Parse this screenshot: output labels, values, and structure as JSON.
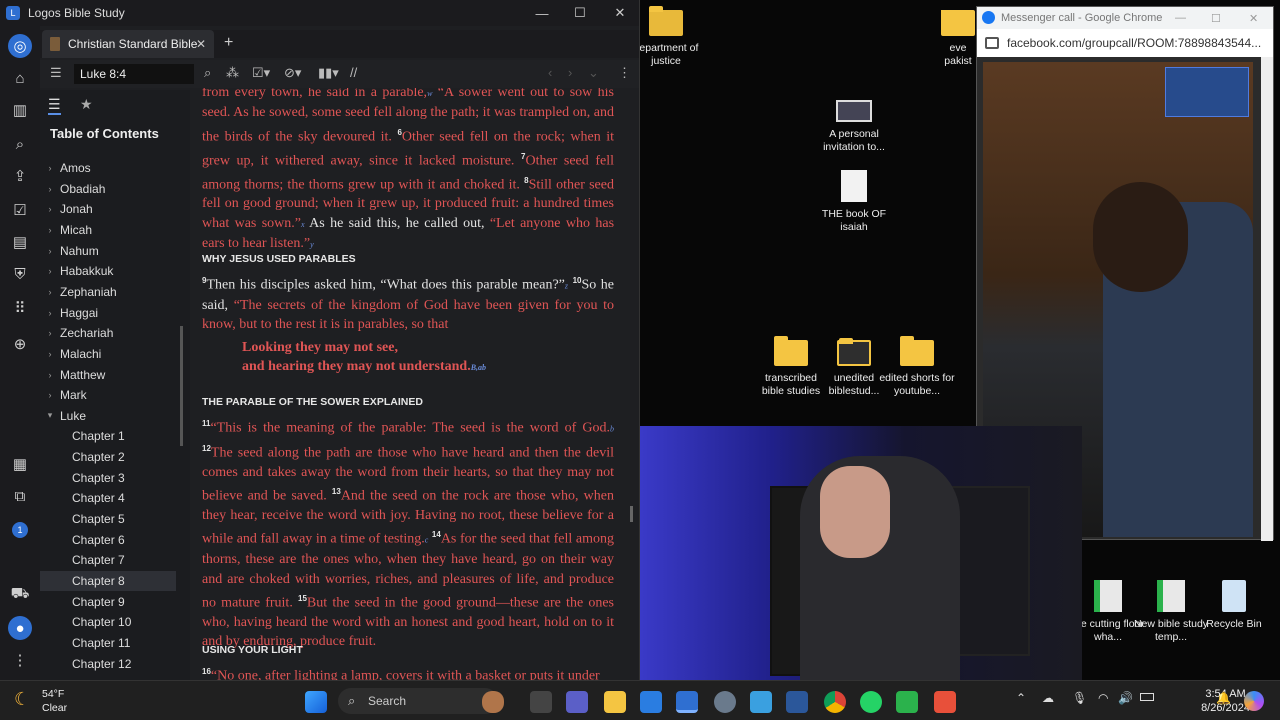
{
  "window": {
    "title": "Logos Bible Study",
    "min": "—",
    "max": "☐",
    "close": "✕"
  },
  "tab": {
    "label": "Christian Standard Bible",
    "close": "✕",
    "new": "+"
  },
  "toolbar": {
    "reference": "Luke 8:4"
  },
  "toc": {
    "heading": "Table of Contents",
    "items": [
      "Amos",
      "Obadiah",
      "Jonah",
      "Micah",
      "Nahum",
      "Habakkuk",
      "Zephaniah",
      "Haggai",
      "Zechariah",
      "Malachi",
      "Matthew",
      "Mark",
      "Luke",
      "Chapter 1",
      "Chapter 2",
      "Chapter 3",
      "Chapter 4",
      "Chapter 5",
      "Chapter 6",
      "Chapter 7",
      "Chapter 8",
      "Chapter 9",
      "Chapter 10",
      "Chapter 11",
      "Chapter 12"
    ],
    "selected": "Chapter 8"
  },
  "reader": {
    "p1_red1": "from every town, he said in a parable,",
    "p1_red2": "A sower went out to sow his seed. As he sowed, some seed fell along the path; it was trampled on, and the birds of the sky devoured it.",
    "v6": "6",
    "p1_red3": "Other seed fell on the rock; when it grew up, it withered away, since it lacked moisture.",
    "v7": "7",
    "p1_red4": "Other seed fell among thorns; the thorns grew up with it and choked it.",
    "v8": "8",
    "p1_red5": "Still other seed fell on good ground; when it grew up, it produced fruit: a hundred times what was sown.”",
    "p1_wht": "As he said this, he called out,",
    "p1_red6": "“Let anyone who has ears to hear listen.”",
    "h1": "WHY JESUS USED PARABLES",
    "v9": "9",
    "p2_wht": "Then his disciples asked him, “What does this parable mean?”",
    "v10": "10",
    "p2_wht2": "So he said,",
    "p2_red": "“The secrets of the kingdom of God have been given for you to know, but to the rest it is in parables, so that",
    "q1": "Looking they may not see,",
    "q2": "and hearing they may not understand.",
    "h2": "THE PARABLE OF THE SOWER EXPLAINED",
    "v11": "11",
    "p3_a": "“This is the meaning of the parable: The seed is the word of God.",
    "v12": "12",
    "p3_b": "The seed along the path are those who have heard and then the devil comes and takes away the word from their hearts, so that they may not believe and be saved.",
    "v13": "13",
    "p3_c": "And the seed on the rock are those who, when they hear, receive the word with joy. Having no root, these believe for a while and fall away in a time of testing.",
    "v14": "14",
    "p3_d": "As for the seed that fell among thorns, these are the ones who, when they have heard, go on their way and are choked with worries, riches, and pleasures of life, and produce no mature fruit.",
    "v15": "15",
    "p3_e": "But the seed in the good ground—these are the ones who, having heard the word with an honest and good heart, hold on to it and by enduring, produce fruit.",
    "h3": "USING YOUR LIGHT",
    "v16": "16",
    "p4": "“No one, after lighting a lamp, covers it with a basket or puts it under"
  },
  "desktop": {
    "icons": [
      "department of justice",
      "A personal invitation to...",
      "THE book OF isaiah",
      "transcribed bible studies",
      "unedited biblestud...",
      "edited shorts for youtube...",
      "the cutting floor wha...",
      "New bible study temp...",
      "Recycle Bin"
    ],
    "partial": "eve pakist"
  },
  "chrome": {
    "title": "Messenger call - Google Chrome",
    "url": "facebook.com/groupcall/ROOM:78898843544..."
  },
  "taskbar": {
    "search": "Search",
    "temp": "54°F",
    "weather": "Clear",
    "time": "3:54 AM",
    "date": "8/26/2024"
  }
}
